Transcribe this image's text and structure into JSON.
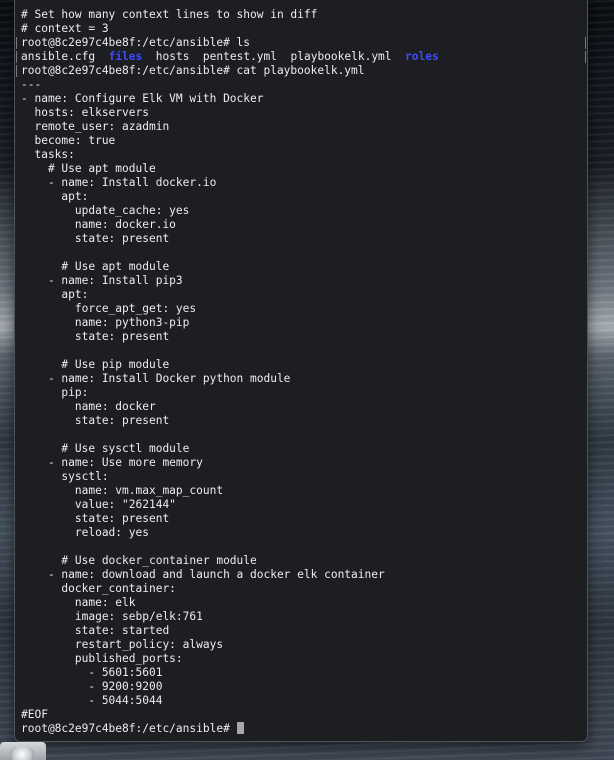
{
  "terminal": {
    "lines": [
      "# Set how many context lines to show in diff",
      "# context = 3",
      "root@8c2e97c4be8f:/etc/ansible# ls",
      "LS_OUTPUT",
      "root@8c2e97c4be8f:/etc/ansible# cat playbookelk.yml",
      "---",
      "- name: Configure Elk VM with Docker",
      "  hosts: elkservers",
      "  remote_user: azadmin",
      "  become: true",
      "  tasks:",
      "    # Use apt module",
      "    - name: Install docker.io",
      "      apt:",
      "        update_cache: yes",
      "        name: docker.io",
      "        state: present",
      "",
      "      # Use apt module",
      "    - name: Install pip3",
      "      apt:",
      "        force_apt_get: yes",
      "        name: python3-pip",
      "        state: present",
      "",
      "      # Use pip module",
      "    - name: Install Docker python module",
      "      pip:",
      "        name: docker",
      "        state: present",
      "",
      "      # Use sysctl module",
      "    - name: Use more memory",
      "      sysctl:",
      "        name: vm.max_map_count",
      "        value: \"262144\"",
      "        state: present",
      "        reload: yes",
      "",
      "      # Use docker_container module",
      "    - name: download and launch a docker elk container",
      "      docker_container:",
      "        name: elk",
      "        image: sebp/elk:761",
      "        state: started",
      "        restart_policy: always",
      "        published_ports:",
      "          - 5601:5601",
      "          - 9200:9200",
      "          - 5044:5044",
      "#EOF"
    ],
    "ls_output": [
      {
        "text": "ansible.cfg",
        "type": "file"
      },
      {
        "text": "files",
        "type": "dir"
      },
      {
        "text": "hosts",
        "type": "file"
      },
      {
        "text": "pentest.yml",
        "type": "file"
      },
      {
        "text": "playbookelk.yml",
        "type": "file"
      },
      {
        "text": "roles",
        "type": "dir"
      }
    ],
    "prompt": "root@8c2e97c4be8f:/etc/ansible# ",
    "colors": {
      "background": "#1c1e22",
      "text": "#ededed",
      "directory": "#3d4bff",
      "cursor": "#a8a8a8"
    }
  },
  "dock": {
    "icon": "finder-like-app-icon"
  }
}
